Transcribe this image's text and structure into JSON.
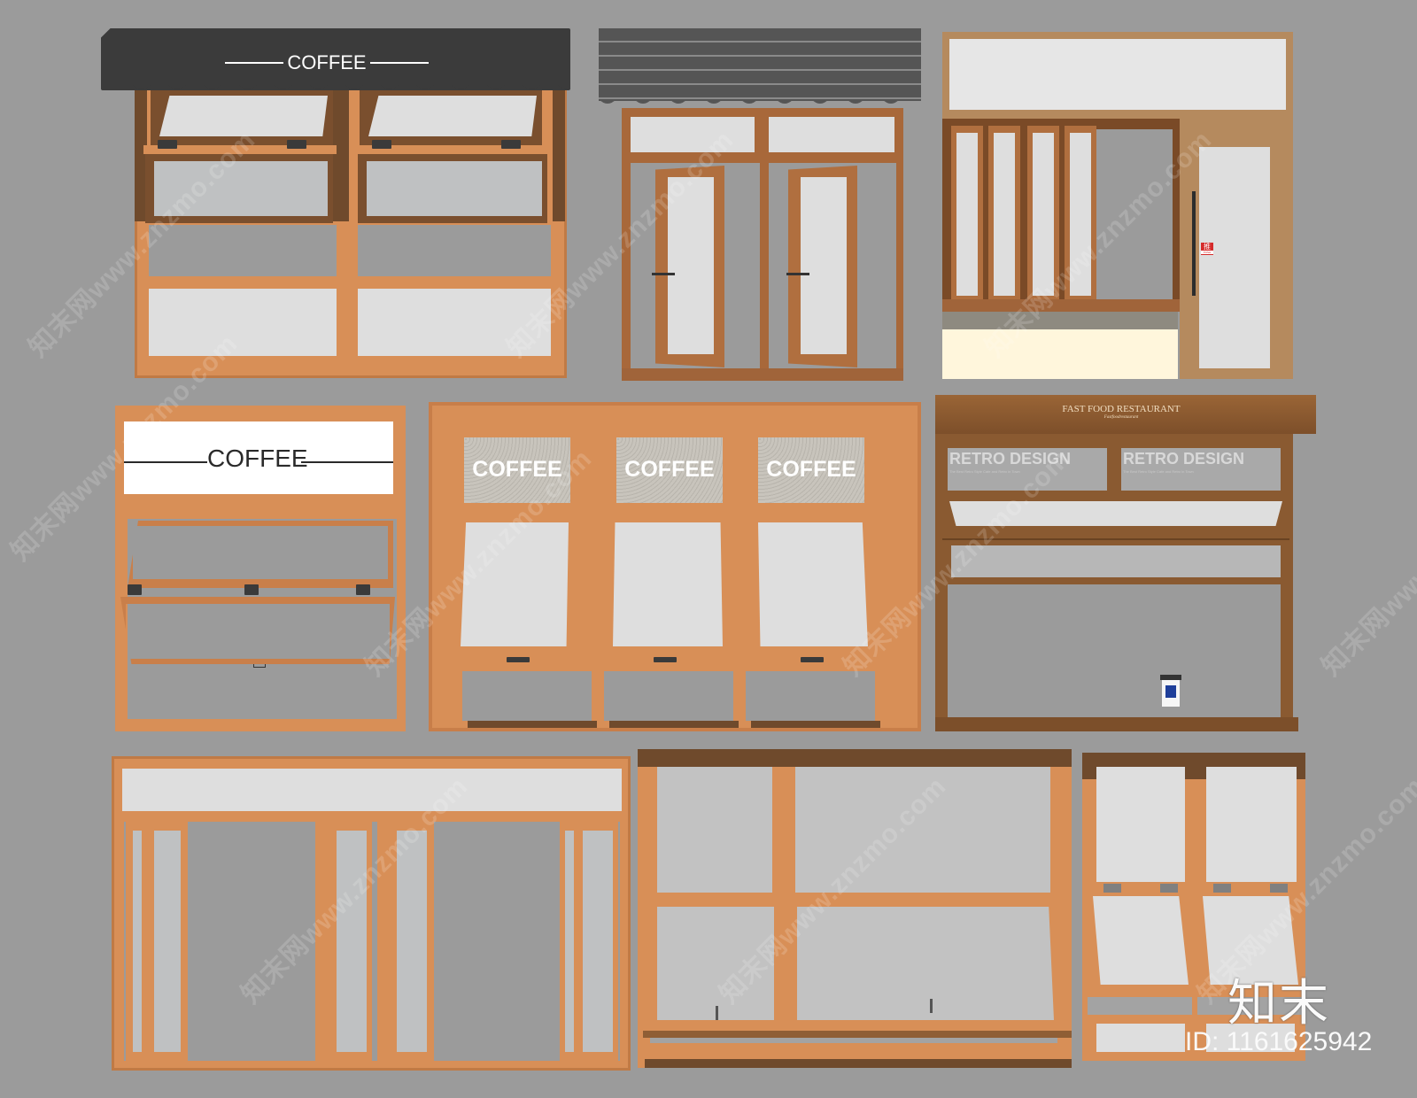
{
  "canvas": {
    "background_color": "#9b9b9b",
    "wood_light_color": "#d88f57",
    "wood_dark_color": "#6f4a2c",
    "glass_color": "#dedede"
  },
  "panels": [
    {
      "id": "awning-coffee-window",
      "awning_text": "COFFEE",
      "awning_color": "#3b3b3b",
      "description": "Double top-hung windows under black fabric awning"
    },
    {
      "id": "awning-french-doors",
      "awning_color": "#555555",
      "description": "Double casement doors under grey striped awning"
    },
    {
      "id": "folding-window-door",
      "door_sticker": "推",
      "door_sticker_sub": "PUSH",
      "description": "Bi-fold windows with light oak door"
    },
    {
      "id": "coffee-sign-window",
      "sign_text": "COFFEE",
      "description": "Top-hung window with white COFFEE sign"
    },
    {
      "id": "triple-coffee-window",
      "panes": [
        "COFFEE",
        "COFFEE",
        "COFFEE"
      ],
      "description": "Triple awning windows with frosted COFFEE transoms"
    },
    {
      "id": "fast-food-window",
      "header_text": "FAST FOOD RESTAURANT",
      "header_subtext": "Fastfoodrestaurant",
      "signs": [
        {
          "title": "RETRO DESIGN",
          "subtitle": "The Best Retro Style Cafe and Retro in Town"
        },
        {
          "title": "RETRO DESIGN",
          "subtitle": "The Best Retro Style Cafe and Retro in Town"
        }
      ],
      "description": "Dark walnut window with coffee cup"
    },
    {
      "id": "folding-door-wide",
      "description": "Wide bi-fold door set with transom"
    },
    {
      "id": "sliding-awning-window",
      "description": "Two-section awning window"
    },
    {
      "id": "double-top-hung-window",
      "description": "Double top-hung windows"
    }
  ],
  "watermark": {
    "site_text": "知末网www.znzmo.com",
    "brand_logo": "知末",
    "id_label": "ID: 1161625942"
  }
}
